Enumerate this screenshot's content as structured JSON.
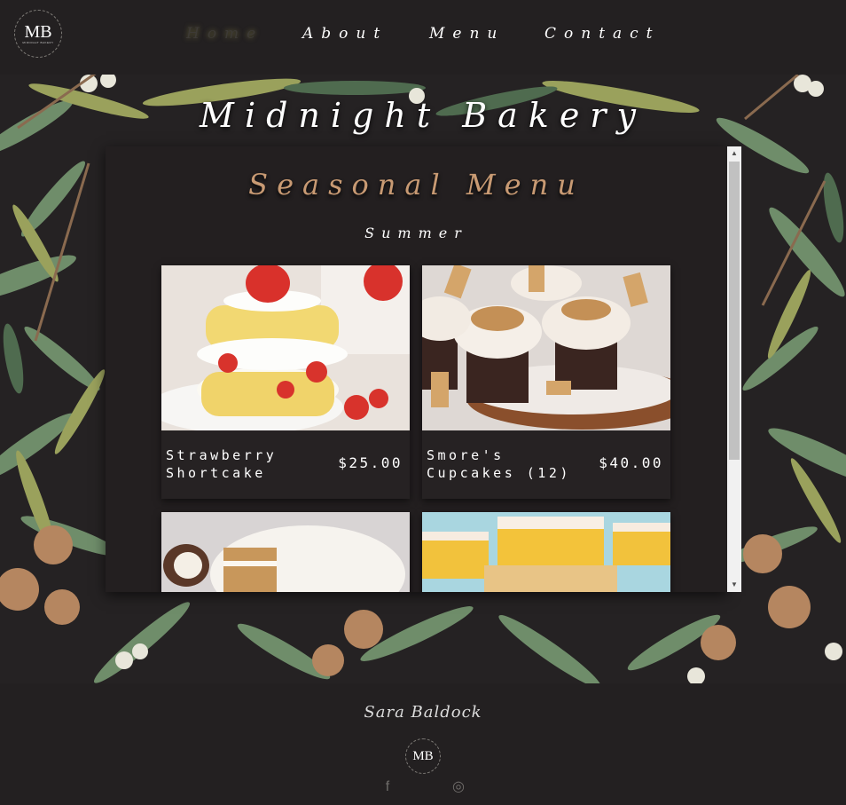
{
  "header": {
    "logo_text": "MB",
    "logo_subtext": "MIDNIGHT BAKERY",
    "nav": [
      {
        "label": "Home",
        "active": true
      },
      {
        "label": "About",
        "active": false
      },
      {
        "label": "Menu",
        "active": false
      },
      {
        "label": "Contact",
        "active": false
      }
    ]
  },
  "site_title": "Midnight Bakery",
  "menu": {
    "heading": "Seasonal Menu",
    "season": "Summer",
    "items": [
      {
        "name": "Strawberry Shortcake",
        "price": "$25.00",
        "photo": "strawberry-shortcake"
      },
      {
        "name": "Smore's Cupcakes (12)",
        "price": "$40.00",
        "photo": "smores-cupcakes"
      },
      {
        "name": "",
        "price": "",
        "photo": "coconut-cake"
      },
      {
        "name": "",
        "price": "",
        "photo": "lemon-bars"
      }
    ]
  },
  "footer": {
    "signature": "Sara Baldock",
    "logo_text": "MB",
    "social": [
      {
        "icon": "facebook-icon",
        "glyph": "f"
      },
      {
        "icon": "instagram-icon",
        "glyph": "◎"
      }
    ]
  },
  "colors": {
    "background": "#232021",
    "accent": "#c89a73",
    "panel": "#231f20"
  }
}
